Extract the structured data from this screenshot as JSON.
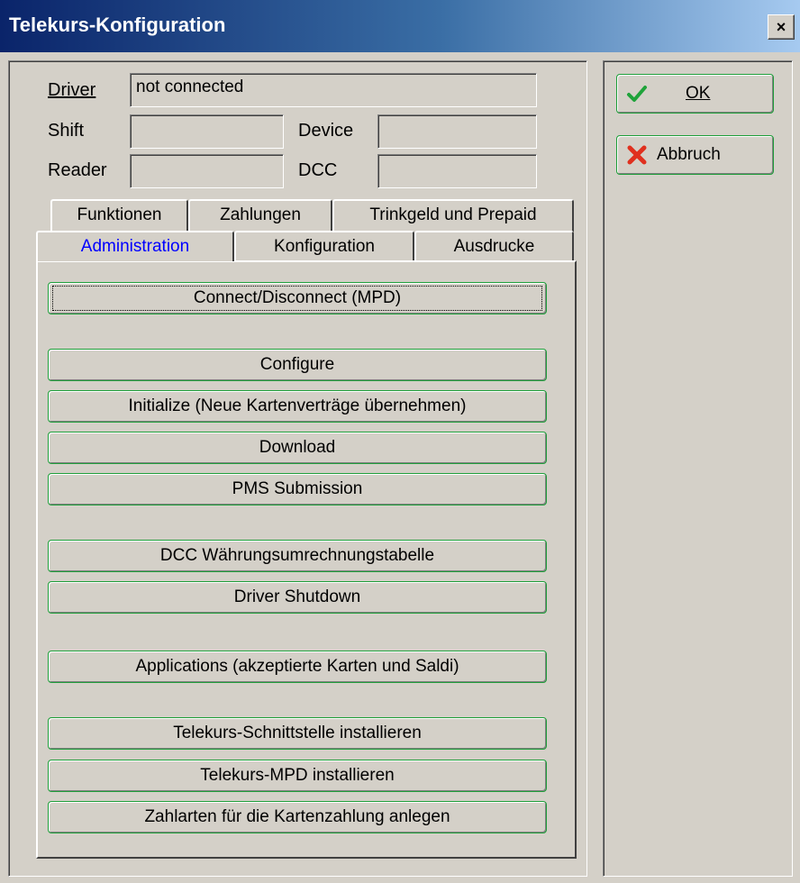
{
  "window": {
    "title": "Telekurs-Konfiguration",
    "close_label": "×"
  },
  "fields": {
    "driver_label": "Driver",
    "driver_value": "not connected",
    "shift_label": "Shift",
    "shift_value": "",
    "device_label": "Device",
    "device_value": "",
    "reader_label": "Reader",
    "reader_value": "",
    "dcc_label": "DCC",
    "dcc_value": ""
  },
  "tabs": {
    "back_row": [
      "Funktionen",
      "Zahlungen",
      "Trinkgeld und Prepaid"
    ],
    "front_row": [
      "Administration",
      "Konfiguration",
      "Ausdrucke"
    ],
    "active": "Administration"
  },
  "actions": [
    "Connect/Disconnect (MPD)",
    "Configure",
    "Initialize (Neue Kartenverträge übernehmen)",
    "Download",
    "PMS Submission",
    "DCC Währungsumrechnungstabelle",
    "Driver Shutdown",
    "Applications (akzeptierte Karten und Saldi)",
    "Telekurs-Schnittstelle installieren",
    "Telekurs-MPD installieren",
    "Zahlarten für die Kartenzahlung anlegen"
  ],
  "dialog_buttons": {
    "ok_label": "OK",
    "ok_icon": "check-icon",
    "ok_color": "#1fa33a",
    "cancel_label": "Abbruch",
    "cancel_icon": "x-icon",
    "cancel_color": "#e0301e"
  }
}
